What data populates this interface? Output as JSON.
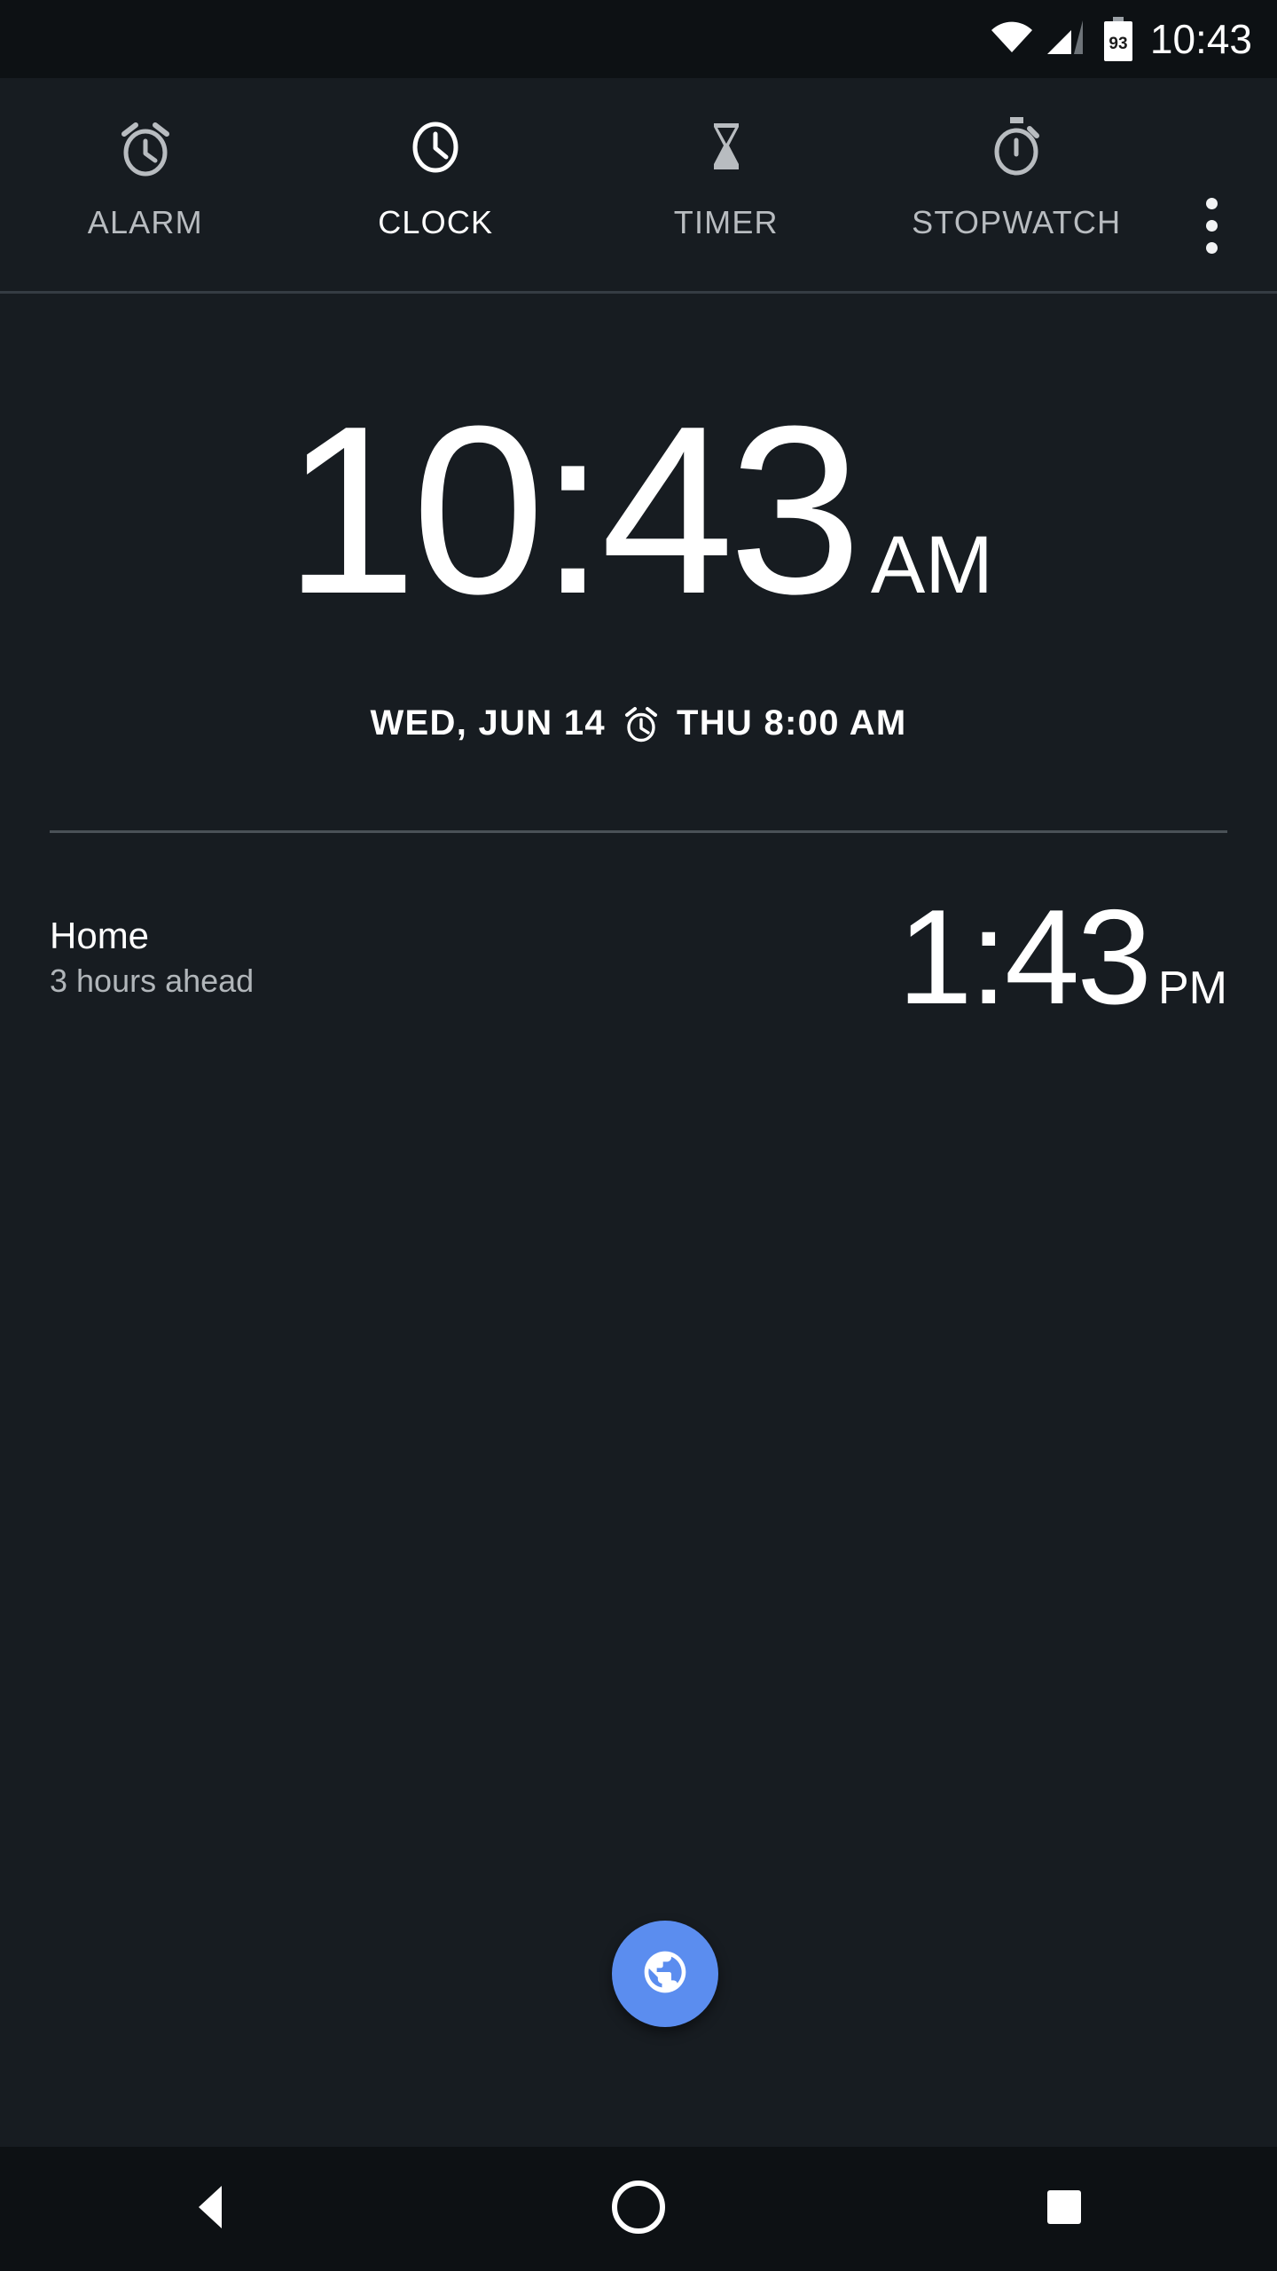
{
  "status_bar": {
    "time": "10:43",
    "battery_level": "93",
    "wifi_icon": "wifi-icon",
    "signal_icon": "cell-signal-icon",
    "battery_icon": "battery-icon"
  },
  "tab_bar": {
    "tabs": [
      {
        "label": "ALARM",
        "icon": "alarm-clock-icon",
        "active": false
      },
      {
        "label": "CLOCK",
        "icon": "clock-icon",
        "active": true
      },
      {
        "label": "TIMER",
        "icon": "hourglass-icon",
        "active": false
      },
      {
        "label": "STOPWATCH",
        "icon": "stopwatch-icon",
        "active": false
      }
    ],
    "overflow_icon": "overflow-menu-icon"
  },
  "main_clock": {
    "time": "10:43",
    "ampm": "AM",
    "date": "WED, JUN 14",
    "alarm_icon": "alarm-clock-icon",
    "next_alarm": "THU 8:00 AM"
  },
  "world_clocks": [
    {
      "city": "Home",
      "offset": "3 hours ahead",
      "time": "1:43",
      "ampm": "PM"
    }
  ],
  "fab": {
    "icon": "globe-icon",
    "color": "#5b8def"
  },
  "nav_bar": {
    "back_icon": "back-triangle-icon",
    "home_icon": "home-circle-icon",
    "recents_icon": "recents-square-icon"
  },
  "colors": {
    "status_bar_bg": "#0d1114",
    "app_bg": "#171c21",
    "accent": "#5b8def",
    "text_primary": "#ffffff",
    "text_secondary": "#b1b6ba",
    "divider": "#4a5157"
  }
}
